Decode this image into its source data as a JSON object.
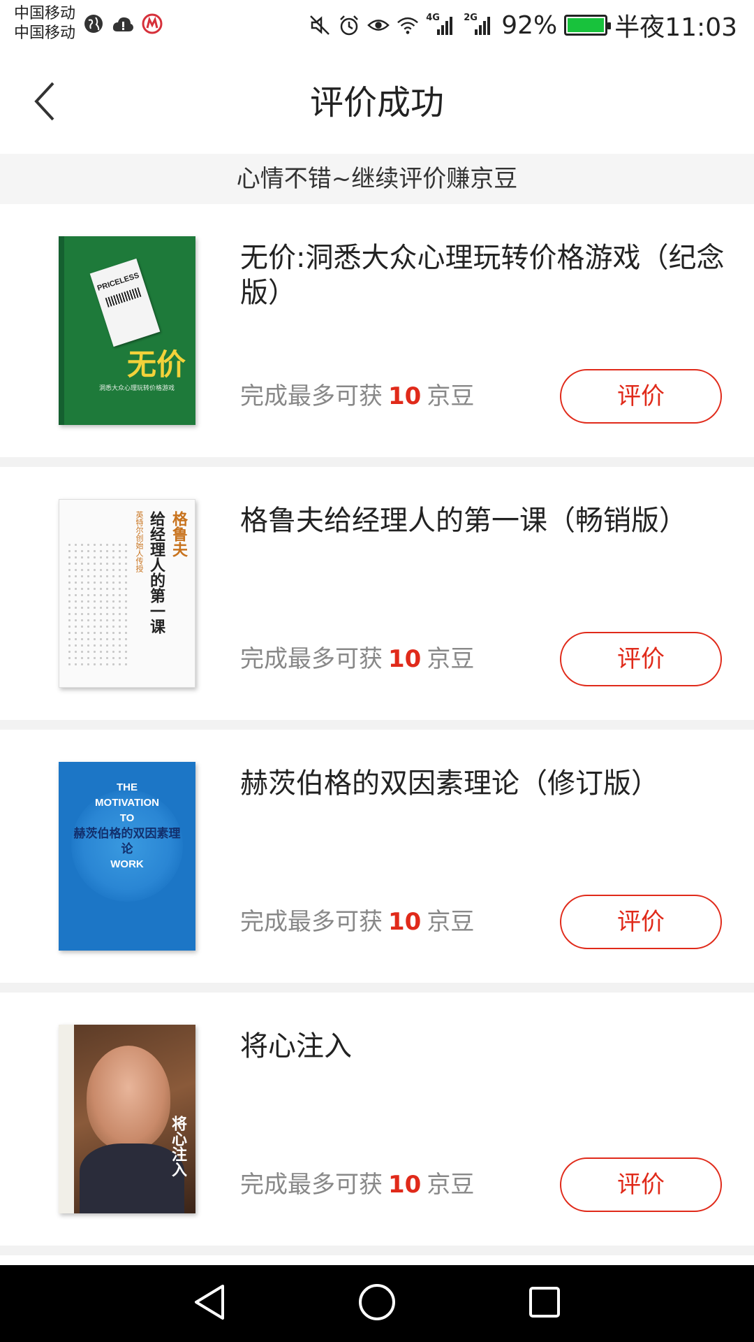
{
  "status_bar": {
    "carrier_1": "中国移动",
    "carrier_2": "中国移动",
    "network_1": "4G",
    "network_2": "2G",
    "battery": "92%",
    "time": "半夜11:03"
  },
  "header": {
    "title": "评价成功"
  },
  "banner": {
    "text": "心情不错~继续评价赚京豆"
  },
  "products": [
    {
      "title": "无价:洞悉大众心理玩转价格游戏（纪念版）",
      "reward_prefix": "完成最多可获",
      "reward_amount": "10",
      "reward_unit": "京豆",
      "button_label": "评价",
      "cover": {
        "main": "无价",
        "sub": "洞悉大众心理玩转价格游戏",
        "tag": "PRICELESS"
      }
    },
    {
      "title": "格鲁夫给经理人的第一课（畅销版）",
      "reward_prefix": "完成最多可获",
      "reward_amount": "10",
      "reward_unit": "京豆",
      "button_label": "评价",
      "cover": {
        "main": "给经理人的第一课",
        "top": "格鲁夫",
        "sub": "英特尔创始人传授"
      }
    },
    {
      "title": "赫茨伯格的双因素理论（修订版）",
      "reward_prefix": "完成最多可获",
      "reward_amount": "10",
      "reward_unit": "京豆",
      "button_label": "评价",
      "cover": {
        "l1": "THE",
        "l2": "MOTIVATION",
        "l3": "TO",
        "zh": "赫茨伯格的双因素理论",
        "l4": "WORK"
      }
    },
    {
      "title": "将心注入",
      "reward_prefix": "完成最多可获",
      "reward_amount": "10",
      "reward_unit": "京豆",
      "button_label": "评价",
      "cover": {
        "main": "将心注入"
      }
    }
  ],
  "colors": {
    "accent": "#e02a1a",
    "banner_bg": "#f5f5f5",
    "divider": "#f2f2f2"
  }
}
